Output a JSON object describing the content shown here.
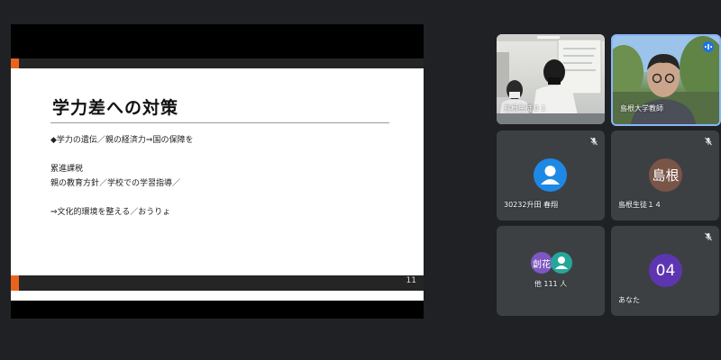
{
  "slide": {
    "title": "学力差への対策",
    "lines": [
      "◆学力の遺伝／親の経済力⇒国の保障を",
      "累進課税",
      "親の教育方針／学校での学習指導／",
      "⇒文化的環境を整える／おうりょ"
    ],
    "page_number": "11"
  },
  "participants": [
    {
      "name": "島根生徒０１",
      "type": "video"
    },
    {
      "name": "島根大学教師",
      "type": "video",
      "speaking": true
    },
    {
      "name": "30232升田 春翔",
      "type": "avatar-icon",
      "muted": true,
      "avatar_color": "#1e88e5"
    },
    {
      "name": "島根生徒１４",
      "type": "avatar-text",
      "avatar_text": "島根",
      "muted": true,
      "avatar_color": "#795548"
    },
    {
      "name": "他 111 人",
      "type": "group",
      "avatar_text": "創花",
      "avatar_color_1": "#7e57c2",
      "avatar_color_2": "#26a69a"
    },
    {
      "name": "あなた",
      "type": "avatar-text",
      "avatar_text": "04",
      "muted": true,
      "avatar_color": "#5e35b1"
    }
  ]
}
